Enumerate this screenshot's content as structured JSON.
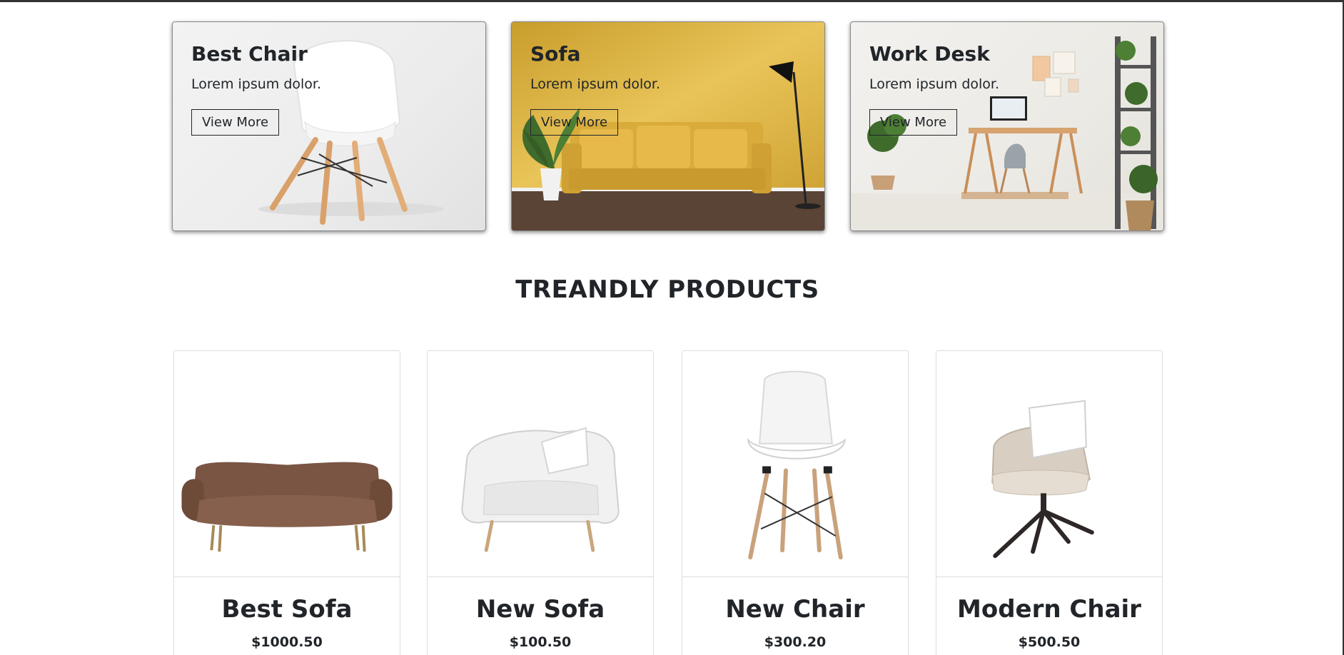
{
  "promos": [
    {
      "title": "Best Chair",
      "text": "Lorem ipsum dolor.",
      "button": "View More",
      "image": "white-chair-image"
    },
    {
      "title": "Sofa",
      "text": "Lorem ipsum dolor.",
      "button": "View More",
      "image": "yellow-sofa-room-image"
    },
    {
      "title": "Work Desk",
      "text": "Lorem ipsum dolor.",
      "button": "View More",
      "image": "work-desk-room-image"
    }
  ],
  "section": {
    "heading": "TREANDLY PRODUCTS"
  },
  "products": [
    {
      "name": "Best Sofa",
      "price": "$1000.50",
      "image": "brown-sofa-image"
    },
    {
      "name": "New Sofa",
      "price": "$100.50",
      "image": "white-armchair-image"
    },
    {
      "name": "New Chair",
      "price": "$300.20",
      "image": "white-chair-image"
    },
    {
      "name": "Modern Chair",
      "price": "$500.50",
      "image": "beige-swivel-chair-image"
    }
  ],
  "colors": {
    "text": "#212529",
    "card_border": "#dcdcdc",
    "sofa_yellow": "#e0b443",
    "sofa_brown": "#7a5543"
  }
}
